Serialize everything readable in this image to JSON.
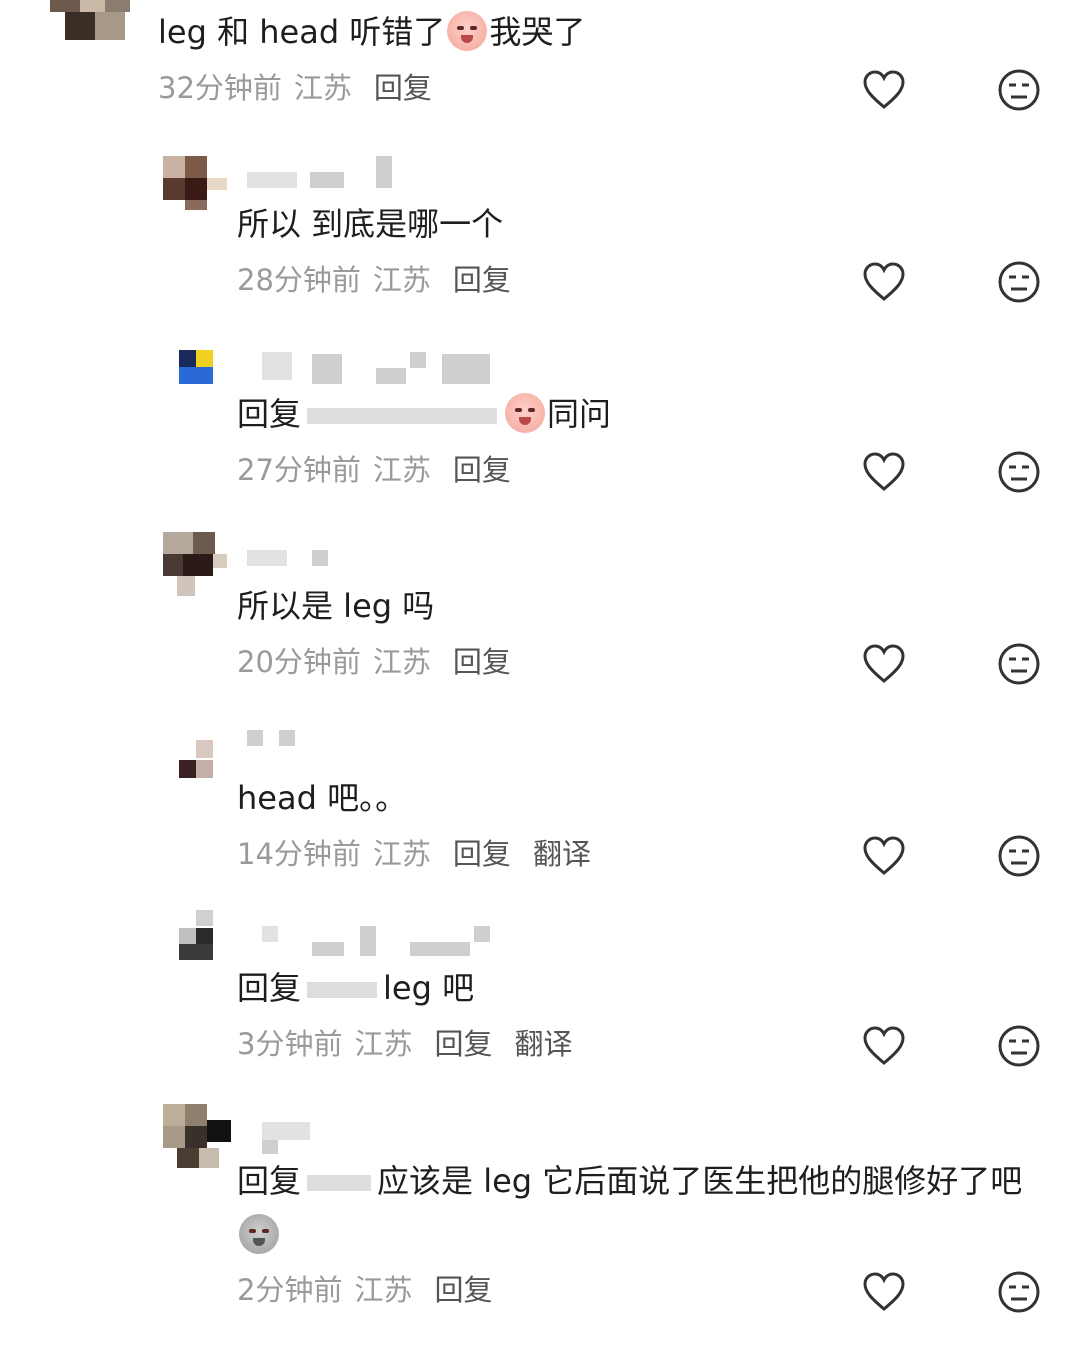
{
  "comments": [
    {
      "text_before": "leg 和 head 听错了",
      "text_after": "我哭了",
      "time": "32分钟前",
      "location": "江苏",
      "reply": "回复"
    },
    {
      "text": "所以 到底是哪一个",
      "time": "28分钟前",
      "location": "江苏",
      "reply": "回复"
    },
    {
      "prefix": "回复",
      "text_after": "同问",
      "time": "27分钟前",
      "location": "江苏",
      "reply": "回复"
    },
    {
      "text": "所以是 leg 吗",
      "time": "20分钟前",
      "location": "江苏",
      "reply": "回复"
    },
    {
      "text": "head 吧。。",
      "time": "14分钟前",
      "location": "江苏",
      "reply": "回复",
      "translate": "翻译"
    },
    {
      "prefix": "回复",
      "text_after": "leg 吧",
      "time": "3分钟前",
      "location": "江苏",
      "reply": "回复",
      "translate": "翻译"
    },
    {
      "prefix": "回复",
      "text_after": "应该是 leg 它后面说了医生把他的腿修好了吧",
      "time": "2分钟前",
      "location": "江苏",
      "reply": "回复"
    }
  ],
  "icons": {
    "like": "heart-outline-icon",
    "dislike": "neutral-face-icon"
  },
  "colors": {
    "text": "#1e1e1e",
    "meta": "#9a9a9a",
    "icon": "#333333"
  }
}
